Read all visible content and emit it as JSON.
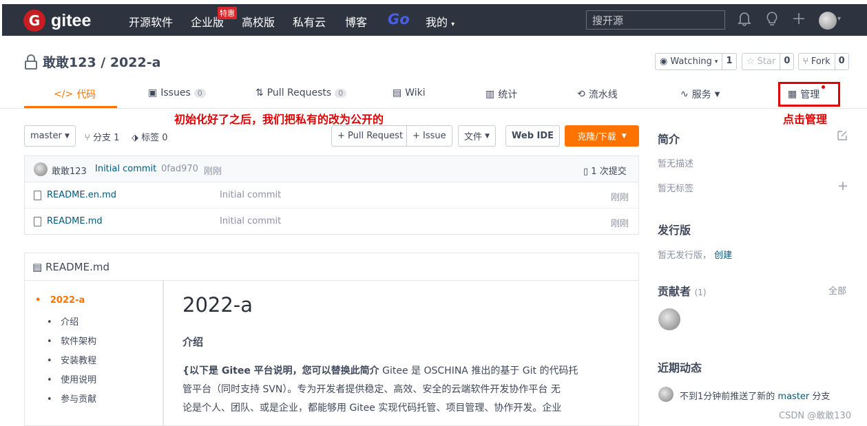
{
  "nav": {
    "logo_text": "gitee",
    "items": [
      "开源软件",
      "企业版",
      "高校版",
      "私有云",
      "博客"
    ],
    "hot_badge": "特惠",
    "go_label": "Go",
    "mine_label": "我的",
    "search_placeholder": "搜开源"
  },
  "repo": {
    "title": "敢敢123 / 2022-a",
    "watching_label": "Watching",
    "watching_count": "1",
    "star_label": "Star",
    "star_count": "0",
    "fork_label": "Fork",
    "fork_count": "0"
  },
  "tabs": {
    "code": "代码",
    "issues": "Issues",
    "issues_count": "0",
    "pull_requests": "Pull Requests",
    "pr_count": "0",
    "wiki": "Wiki",
    "stats": "统计",
    "pipeline": "流水线",
    "services": "服务",
    "manage": "管理"
  },
  "annotations": {
    "main_note": "初始化好了之后，我们把私有的改为公开的",
    "manage_note": "点击管理"
  },
  "toolbar": {
    "branch": "master",
    "branches": "分支 1",
    "tags": "标签 0",
    "pull_request": "+ Pull Request",
    "issue": "+ Issue",
    "files": "文件",
    "web_ide": "Web IDE",
    "clone": "克隆/下载"
  },
  "commit": {
    "author": "敢敢123",
    "message": "Initial commit",
    "hash": "0fad970",
    "time": "刚刚",
    "commits": "1 次提交"
  },
  "files": [
    {
      "name": "README.en.md",
      "message": "Initial commit",
      "time": "刚刚"
    },
    {
      "name": "README.md",
      "message": "Initial commit",
      "time": "刚刚"
    }
  ],
  "readme": {
    "filename": "README.md",
    "toc": [
      "2022-a",
      "介绍",
      "软件架构",
      "安装教程",
      "使用说明",
      "参与贡献"
    ],
    "title": "2022-a",
    "section": "介绍",
    "para_bold": "{以下是 Gitee 平台说明，您可以替换此简介",
    "para_line1": " Gitee 是 OSCHINA 推出的基于 Git 的代码托",
    "para_line2": "管平台（同时支持 SVN）。专为开发者提供稳定、高效、安全的云端软件开发协作平台 无",
    "para_line3": "论是个人、团队、或是企业，都能够用 Gitee 实现代码托管、项目管理、协作开发。企业"
  },
  "sidebar": {
    "intro_title": "简介",
    "no_desc": "暂无描述",
    "no_tags": "暂无标签",
    "release_title": "发行版",
    "no_release": "暂无发行版，",
    "create": "创建",
    "contributors_title": "贡献者",
    "contributors_count": "(1)",
    "all": "全部",
    "activity_title": "近期动态",
    "activity_text": "不到1分钟前推送了新的",
    "activity_branch": "master",
    "activity_suffix": "分支"
  },
  "watermark": "CSDN @敢敢130",
  "colors": {
    "accent": "#fe7300",
    "nav_bg": "#2d333f",
    "annotation": "#e10000",
    "link": "#005980"
  }
}
